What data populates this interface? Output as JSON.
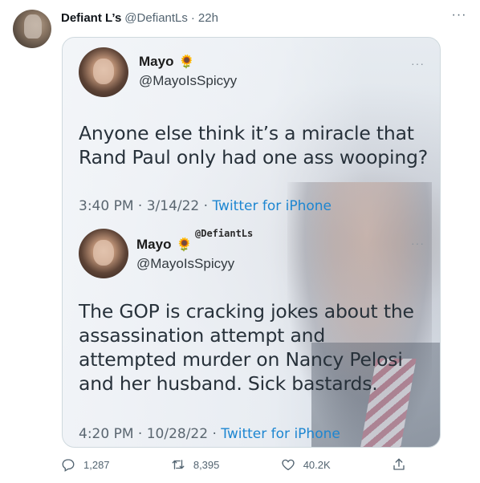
{
  "tweet": {
    "author_name": "Defiant L’s",
    "handle": "@DefiantLs",
    "separator": "·",
    "time": "22h",
    "more_glyph": "···"
  },
  "quoted_tweet_1": {
    "name": "Mayo",
    "emoji": "🌻",
    "handle": "@MayoIsSpicyy",
    "more_glyph": "···",
    "text": "Anyone else think it’s a miracle that Rand Paul only had one ass wooping?",
    "time": "3:40 PM · 3/14/22 · ",
    "source": "Twitter for iPhone"
  },
  "quoted_tweet_2": {
    "name": "Mayo",
    "emoji": "🌻",
    "handle": "@MayoIsSpicyy",
    "more_glyph": "···",
    "text": "The GOP is cracking jokes about the assassination attempt and attempted murder on Nancy Pelosi and her husband. Sick bastards.",
    "time": "4:20 PM · 10/28/22 · ",
    "source": "Twitter for iPhone"
  },
  "watermark": "@DefiantLs",
  "actions": {
    "replies": "1,287",
    "retweets": "8,395",
    "likes": "40.2K"
  },
  "icons": {
    "reply": "reply-icon",
    "retweet": "retweet-icon",
    "like": "heart-icon",
    "share": "share-icon",
    "more": "more-icon"
  }
}
